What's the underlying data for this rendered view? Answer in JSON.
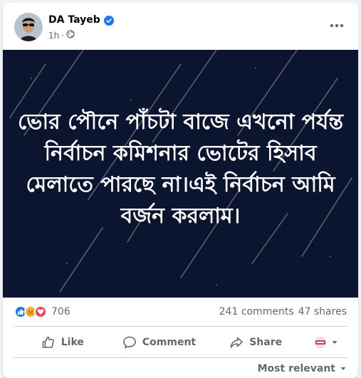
{
  "post": {
    "author": "DA Tayeb",
    "time": "1h",
    "audience_icon": "globe-icon",
    "text": "ভোর পৌনে পাঁচটা বাজে এখনো পর্যন্ত নির্বাচন কমিশনার ভোটের হিসাব মেলাতে পারছে না।এই নির্বাচন আমি বর্জন করলাম।"
  },
  "stats": {
    "reactions": [
      "like",
      "care",
      "love"
    ],
    "reaction_count": "706",
    "comments": "241 comments",
    "shares": "47 shares"
  },
  "actions": {
    "like": "Like",
    "comment": "Comment",
    "share": "Share"
  },
  "comments_sort": {
    "label": "Most relevant"
  },
  "colors": {
    "accent": "#1877f2",
    "love": "#f33e58",
    "care": "#f7b125",
    "image_bg": "#0c1530"
  }
}
